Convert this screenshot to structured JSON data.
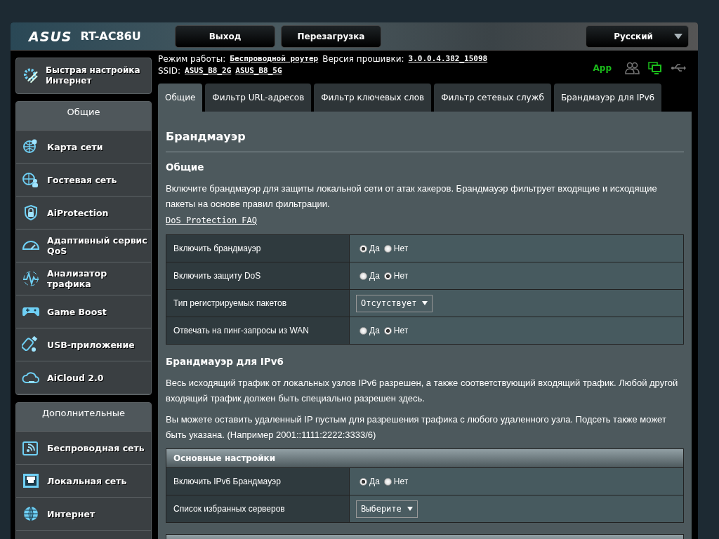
{
  "header": {
    "logo": "ASUS",
    "model": "RT-AC86U",
    "buttons": [
      "Выход",
      "Перезагрузка"
    ],
    "language": "Русский"
  },
  "status": {
    "mode_label": "Режим работы:",
    "mode_value": "Беспроводной роутер",
    "firmware_label": "Версия прошивки:",
    "firmware_value": "3.0.0.4.382_15098",
    "ssid_label": "SSID:",
    "ssids": [
      "ASUS_B8_2G",
      "ASUS_B8_5G"
    ],
    "app": "App"
  },
  "quick_setup": "Быстрая настройка Интернет",
  "sidebar": [
    {
      "title": "Общие",
      "items": [
        "Карта сети",
        "Гостевая сеть",
        "AiProtection",
        "Адаптивный сервис QoS",
        "Анализатор трафика",
        "Game Boost",
        "USB-приложение",
        "AiCloud 2.0"
      ]
    },
    {
      "title": "Дополнительные",
      "items": [
        "Беспроводная сеть",
        "Локальная сеть",
        "Интернет"
      ]
    }
  ],
  "tabs": [
    {
      "label": "Общие",
      "selected": true
    },
    {
      "label": "Фильтр URL-адресов",
      "selected": false
    },
    {
      "label": "Фильтр ключевых слов",
      "selected": false
    },
    {
      "label": "Фильтр сетевых служб",
      "selected": false
    },
    {
      "label": "Брандмауэр для IPv6",
      "selected": false
    }
  ],
  "content": {
    "title": "Брандмауэр",
    "sections": [
      {
        "heading": "Общие",
        "paragraphs": [
          "Включите брандмауэр для защиты локальной сети от атак хакеров. Брандмауэр фильтрует входящие и исходящие пакеты на основе правил фильтрации."
        ],
        "link": "DoS Protection FAQ",
        "tables": [
          {
            "rows": [
              {
                "label": "Включить брандмауэр",
                "kind": "radio",
                "options": [
                  {
                    "label": "Да",
                    "selected": true
                  },
                  {
                    "label": "Нет",
                    "selected": false
                  }
                ]
              },
              {
                "label": "Включить защиту DoS",
                "kind": "radio",
                "options": [
                  {
                    "label": "Да",
                    "selected": false
                  },
                  {
                    "label": "Нет",
                    "selected": true
                  }
                ]
              },
              {
                "label": "Тип регистрируемых пакетов",
                "kind": "select",
                "value": "Отсутствует"
              },
              {
                "label": "Отвечать на пинг-запросы из WAN",
                "kind": "radio",
                "options": [
                  {
                    "label": "Да",
                    "selected": false
                  },
                  {
                    "label": "Нет",
                    "selected": true
                  }
                ]
              }
            ]
          }
        ]
      },
      {
        "heading": "Брандмауэр для IPv6",
        "paragraphs": [
          "Весь исходящий трафик от локальных узлов IPv6 разрешен, а также соответствующий входящий трафик. Любой другой входящий трафик должен быть специально разрешен здесь.",
          "Вы можете оставить удаленный IP пустым для разрешения трафика с любого удаленного узла. Подсеть также может быть указана. (Например 2001::1111:2222:3333/6)"
        ],
        "tables": [
          {
            "title": "Основные настройки",
            "rows": [
              {
                "label": "Включить IPv6 Брандмауэр",
                "kind": "radio",
                "options": [
                  {
                    "label": "Да",
                    "selected": true
                  },
                  {
                    "label": "Нет",
                    "selected": false
                  }
                ]
              },
              {
                "label": "Список избранных серверов",
                "kind": "select",
                "value": "Выберите"
              }
            ]
          }
        ]
      }
    ]
  }
}
